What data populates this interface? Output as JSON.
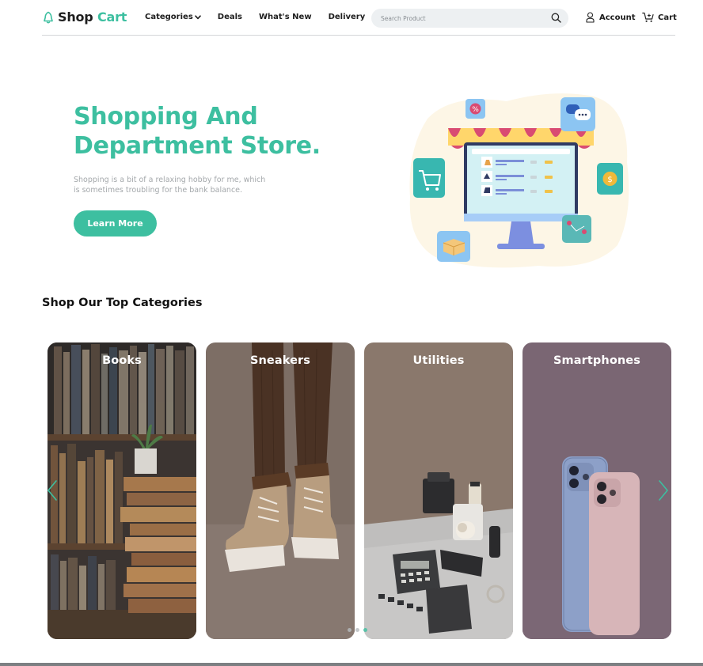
{
  "brand": {
    "name_part1": "Shop",
    "name_part2": "Cart",
    "accent": "#3dbfa0"
  },
  "nav": {
    "items": [
      {
        "label": "Categories",
        "has_dropdown": true
      },
      {
        "label": "Deals"
      },
      {
        "label": "What's New"
      },
      {
        "label": "Delivery"
      }
    ],
    "search": {
      "placeholder": "Search Product",
      "icon": "search-icon"
    },
    "account_label": "Account",
    "cart_label": "Cart"
  },
  "hero": {
    "title_line1": "Shopping And",
    "title_line2": "Department Store.",
    "subtitle_line1": "Shopping is a bit of a relaxing hobby for me, which",
    "subtitle_line2": "is sometimes troubling for the bank balance.",
    "cta_label": "Learn More",
    "illustration": "online-store-illustration"
  },
  "categories": {
    "title": "Shop Our Top Categories",
    "items": [
      {
        "label": "Books",
        "image": "bookshelf-with-plant"
      },
      {
        "label": "Sneakers",
        "image": "person-wearing-boots"
      },
      {
        "label": "Utilities",
        "image": "office-stationery-items"
      },
      {
        "label": "Smartphones",
        "image": "two-iphones"
      }
    ],
    "carousel": {
      "pages": 3,
      "active_page": 3
    }
  }
}
